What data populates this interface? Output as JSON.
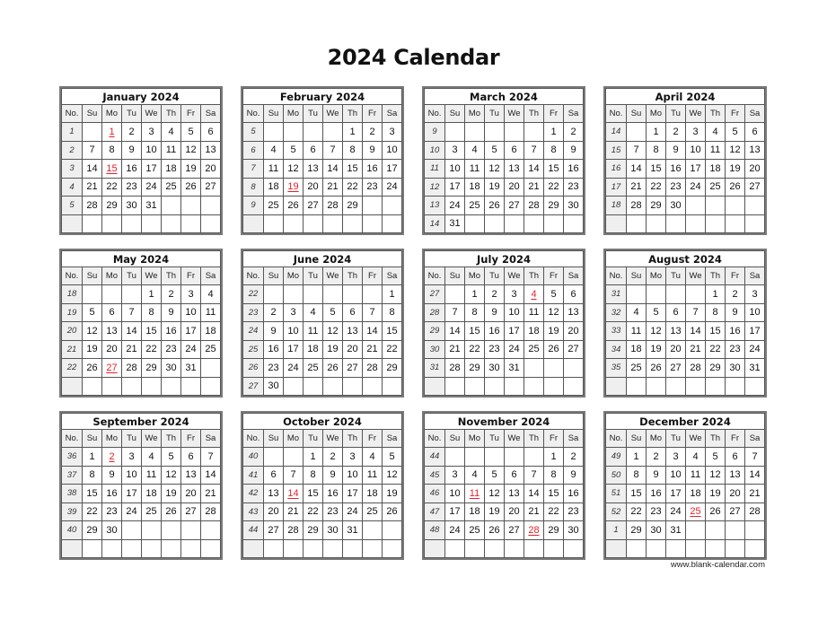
{
  "title": "2024 Calendar",
  "day_headers": [
    "No.",
    "Su",
    "Mo",
    "Tu",
    "We",
    "Th",
    "Fr",
    "Sa"
  ],
  "holiday_color": "#e8202a",
  "months": [
    {
      "name": "January 2024",
      "weeks": [
        {
          "no": "1",
          "days": [
            "",
            "1",
            "2",
            "3",
            "4",
            "5",
            "6"
          ]
        },
        {
          "no": "2",
          "days": [
            "7",
            "8",
            "9",
            "10",
            "11",
            "12",
            "13"
          ]
        },
        {
          "no": "3",
          "days": [
            "14",
            "15",
            "16",
            "17",
            "18",
            "19",
            "20"
          ]
        },
        {
          "no": "4",
          "days": [
            "21",
            "22",
            "23",
            "24",
            "25",
            "26",
            "27"
          ]
        },
        {
          "no": "5",
          "days": [
            "28",
            "29",
            "30",
            "31",
            "",
            "",
            ""
          ]
        },
        {
          "no": "",
          "days": [
            "",
            "",
            "",
            "",
            "",
            "",
            ""
          ]
        }
      ],
      "holidays": [
        "1",
        "15"
      ]
    },
    {
      "name": "February 2024",
      "weeks": [
        {
          "no": "5",
          "days": [
            "",
            "",
            "",
            "",
            "1",
            "2",
            "3"
          ]
        },
        {
          "no": "6",
          "days": [
            "4",
            "5",
            "6",
            "7",
            "8",
            "9",
            "10"
          ]
        },
        {
          "no": "7",
          "days": [
            "11",
            "12",
            "13",
            "14",
            "15",
            "16",
            "17"
          ]
        },
        {
          "no": "8",
          "days": [
            "18",
            "19",
            "20",
            "21",
            "22",
            "23",
            "24"
          ]
        },
        {
          "no": "9",
          "days": [
            "25",
            "26",
            "27",
            "28",
            "29",
            "",
            ""
          ]
        },
        {
          "no": "",
          "days": [
            "",
            "",
            "",
            "",
            "",
            "",
            ""
          ]
        }
      ],
      "holidays": [
        "19"
      ]
    },
    {
      "name": "March 2024",
      "weeks": [
        {
          "no": "9",
          "days": [
            "",
            "",
            "",
            "",
            "",
            "1",
            "2"
          ]
        },
        {
          "no": "10",
          "days": [
            "3",
            "4",
            "5",
            "6",
            "7",
            "8",
            "9"
          ]
        },
        {
          "no": "11",
          "days": [
            "10",
            "11",
            "12",
            "13",
            "14",
            "15",
            "16"
          ]
        },
        {
          "no": "12",
          "days": [
            "17",
            "18",
            "19",
            "20",
            "21",
            "22",
            "23"
          ]
        },
        {
          "no": "13",
          "days": [
            "24",
            "25",
            "26",
            "27",
            "28",
            "29",
            "30"
          ]
        },
        {
          "no": "14",
          "days": [
            "31",
            "",
            "",
            "",
            "",
            "",
            ""
          ]
        }
      ],
      "holidays": []
    },
    {
      "name": "April 2024",
      "weeks": [
        {
          "no": "14",
          "days": [
            "",
            "1",
            "2",
            "3",
            "4",
            "5",
            "6"
          ]
        },
        {
          "no": "15",
          "days": [
            "7",
            "8",
            "9",
            "10",
            "11",
            "12",
            "13"
          ]
        },
        {
          "no": "16",
          "days": [
            "14",
            "15",
            "16",
            "17",
            "18",
            "19",
            "20"
          ]
        },
        {
          "no": "17",
          "days": [
            "21",
            "22",
            "23",
            "24",
            "25",
            "26",
            "27"
          ]
        },
        {
          "no": "18",
          "days": [
            "28",
            "29",
            "30",
            "",
            "",
            "",
            ""
          ]
        },
        {
          "no": "",
          "days": [
            "",
            "",
            "",
            "",
            "",
            "",
            ""
          ]
        }
      ],
      "holidays": []
    },
    {
      "name": "May 2024",
      "weeks": [
        {
          "no": "18",
          "days": [
            "",
            "",
            "",
            "1",
            "2",
            "3",
            "4"
          ]
        },
        {
          "no": "19",
          "days": [
            "5",
            "6",
            "7",
            "8",
            "9",
            "10",
            "11"
          ]
        },
        {
          "no": "20",
          "days": [
            "12",
            "13",
            "14",
            "15",
            "16",
            "17",
            "18"
          ]
        },
        {
          "no": "21",
          "days": [
            "19",
            "20",
            "21",
            "22",
            "23",
            "24",
            "25"
          ]
        },
        {
          "no": "22",
          "days": [
            "26",
            "27",
            "28",
            "29",
            "30",
            "31",
            ""
          ]
        },
        {
          "no": "",
          "days": [
            "",
            "",
            "",
            "",
            "",
            "",
            ""
          ]
        }
      ],
      "holidays": [
        "27"
      ]
    },
    {
      "name": "June 2024",
      "weeks": [
        {
          "no": "22",
          "days": [
            "",
            "",
            "",
            "",
            "",
            "",
            "1"
          ]
        },
        {
          "no": "23",
          "days": [
            "2",
            "3",
            "4",
            "5",
            "6",
            "7",
            "8"
          ]
        },
        {
          "no": "24",
          "days": [
            "9",
            "10",
            "11",
            "12",
            "13",
            "14",
            "15"
          ]
        },
        {
          "no": "25",
          "days": [
            "16",
            "17",
            "18",
            "19",
            "20",
            "21",
            "22"
          ]
        },
        {
          "no": "26",
          "days": [
            "23",
            "24",
            "25",
            "26",
            "27",
            "28",
            "29"
          ]
        },
        {
          "no": "27",
          "days": [
            "30",
            "",
            "",
            "",
            "",
            "",
            ""
          ]
        }
      ],
      "holidays": []
    },
    {
      "name": "July 2024",
      "weeks": [
        {
          "no": "27",
          "days": [
            "",
            "1",
            "2",
            "3",
            "4",
            "5",
            "6"
          ]
        },
        {
          "no": "28",
          "days": [
            "7",
            "8",
            "9",
            "10",
            "11",
            "12",
            "13"
          ]
        },
        {
          "no": "29",
          "days": [
            "14",
            "15",
            "16",
            "17",
            "18",
            "19",
            "20"
          ]
        },
        {
          "no": "30",
          "days": [
            "21",
            "22",
            "23",
            "24",
            "25",
            "26",
            "27"
          ]
        },
        {
          "no": "31",
          "days": [
            "28",
            "29",
            "30",
            "31",
            "",
            "",
            ""
          ]
        },
        {
          "no": "",
          "days": [
            "",
            "",
            "",
            "",
            "",
            "",
            ""
          ]
        }
      ],
      "holidays": [
        "4"
      ]
    },
    {
      "name": "August 2024",
      "weeks": [
        {
          "no": "31",
          "days": [
            "",
            "",
            "",
            "",
            "1",
            "2",
            "3"
          ]
        },
        {
          "no": "32",
          "days": [
            "4",
            "5",
            "6",
            "7",
            "8",
            "9",
            "10"
          ]
        },
        {
          "no": "33",
          "days": [
            "11",
            "12",
            "13",
            "14",
            "15",
            "16",
            "17"
          ]
        },
        {
          "no": "34",
          "days": [
            "18",
            "19",
            "20",
            "21",
            "22",
            "23",
            "24"
          ]
        },
        {
          "no": "35",
          "days": [
            "25",
            "26",
            "27",
            "28",
            "29",
            "30",
            "31"
          ]
        },
        {
          "no": "",
          "days": [
            "",
            "",
            "",
            "",
            "",
            "",
            ""
          ]
        }
      ],
      "holidays": []
    },
    {
      "name": "September 2024",
      "weeks": [
        {
          "no": "36",
          "days": [
            "1",
            "2",
            "3",
            "4",
            "5",
            "6",
            "7"
          ]
        },
        {
          "no": "37",
          "days": [
            "8",
            "9",
            "10",
            "11",
            "12",
            "13",
            "14"
          ]
        },
        {
          "no": "38",
          "days": [
            "15",
            "16",
            "17",
            "18",
            "19",
            "20",
            "21"
          ]
        },
        {
          "no": "39",
          "days": [
            "22",
            "23",
            "24",
            "25",
            "26",
            "27",
            "28"
          ]
        },
        {
          "no": "40",
          "days": [
            "29",
            "30",
            "",
            "",
            "",
            "",
            ""
          ]
        },
        {
          "no": "",
          "days": [
            "",
            "",
            "",
            "",
            "",
            "",
            ""
          ]
        }
      ],
      "holidays": [
        "2"
      ]
    },
    {
      "name": "October 2024",
      "weeks": [
        {
          "no": "40",
          "days": [
            "",
            "",
            "1",
            "2",
            "3",
            "4",
            "5"
          ]
        },
        {
          "no": "41",
          "days": [
            "6",
            "7",
            "8",
            "9",
            "10",
            "11",
            "12"
          ]
        },
        {
          "no": "42",
          "days": [
            "13",
            "14",
            "15",
            "16",
            "17",
            "18",
            "19"
          ]
        },
        {
          "no": "43",
          "days": [
            "20",
            "21",
            "22",
            "23",
            "24",
            "25",
            "26"
          ]
        },
        {
          "no": "44",
          "days": [
            "27",
            "28",
            "29",
            "30",
            "31",
            "",
            ""
          ]
        },
        {
          "no": "",
          "days": [
            "",
            "",
            "",
            "",
            "",
            "",
            ""
          ]
        }
      ],
      "holidays": [
        "14"
      ]
    },
    {
      "name": "November 2024",
      "weeks": [
        {
          "no": "44",
          "days": [
            "",
            "",
            "",
            "",
            "",
            "1",
            "2"
          ]
        },
        {
          "no": "45",
          "days": [
            "3",
            "4",
            "5",
            "6",
            "7",
            "8",
            "9"
          ]
        },
        {
          "no": "46",
          "days": [
            "10",
            "11",
            "12",
            "13",
            "14",
            "15",
            "16"
          ]
        },
        {
          "no": "47",
          "days": [
            "17",
            "18",
            "19",
            "20",
            "21",
            "22",
            "23"
          ]
        },
        {
          "no": "48",
          "days": [
            "24",
            "25",
            "26",
            "27",
            "28",
            "29",
            "30"
          ]
        },
        {
          "no": "",
          "days": [
            "",
            "",
            "",
            "",
            "",
            "",
            ""
          ]
        }
      ],
      "holidays": [
        "11",
        "28"
      ]
    },
    {
      "name": "December 2024",
      "weeks": [
        {
          "no": "49",
          "days": [
            "1",
            "2",
            "3",
            "4",
            "5",
            "6",
            "7"
          ]
        },
        {
          "no": "50",
          "days": [
            "8",
            "9",
            "10",
            "11",
            "12",
            "13",
            "14"
          ]
        },
        {
          "no": "51",
          "days": [
            "15",
            "16",
            "17",
            "18",
            "19",
            "20",
            "21"
          ]
        },
        {
          "no": "52",
          "days": [
            "22",
            "23",
            "24",
            "25",
            "26",
            "27",
            "28"
          ]
        },
        {
          "no": "1",
          "days": [
            "29",
            "30",
            "31",
            "",
            "",
            "",
            ""
          ]
        },
        {
          "no": "",
          "days": [
            "",
            "",
            "",
            "",
            "",
            "",
            ""
          ]
        }
      ],
      "holidays": [
        "25"
      ]
    }
  ],
  "footer": "www.blank-calendar.com"
}
